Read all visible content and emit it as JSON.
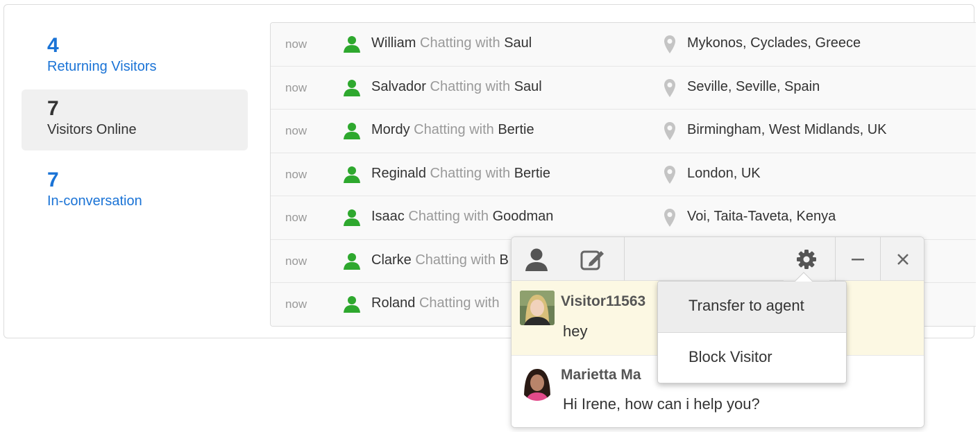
{
  "stats": [
    {
      "count": "4",
      "label": "Returning Visitors"
    },
    {
      "count": "7",
      "label": "Visitors Online"
    },
    {
      "count": "7",
      "label": "In-conversation"
    }
  ],
  "visitors": [
    {
      "time": "now",
      "name": "William",
      "status": "Chatting with",
      "agent": "Saul",
      "location": "Mykonos, Cyclades, Greece"
    },
    {
      "time": "now",
      "name": "Salvador",
      "status": "Chatting with",
      "agent": "Saul",
      "location": "Seville, Seville, Spain"
    },
    {
      "time": "now",
      "name": "Mordy",
      "status": "Chatting with",
      "agent": "Bertie",
      "location": "Birmingham, West Midlands, UK"
    },
    {
      "time": "now",
      "name": "Reginald",
      "status": "Chatting with",
      "agent": "Bertie",
      "location": "London, UK"
    },
    {
      "time": "now",
      "name": "Isaac",
      "status": "Chatting with",
      "agent": "Goodman",
      "location": "Voi, Taita-Taveta, Kenya"
    },
    {
      "time": "now",
      "name": "Clarke",
      "status": "Chatting with",
      "agent": "B",
      "location": ""
    },
    {
      "time": "now",
      "name": "Roland",
      "status": "Chatting with",
      "agent": "",
      "location": ""
    }
  ],
  "chat": {
    "messages": [
      {
        "sender": "Visitor11563",
        "text": "hey"
      },
      {
        "sender": "Marietta Ma",
        "text": "Hi Irene, how can i help you?"
      }
    ],
    "menu": {
      "transfer_label": "Transfer to agent",
      "block_label": "Block Visitor"
    }
  },
  "icons": {
    "visitor_row": "user-icon",
    "location": "map-pin-icon",
    "toolbar": [
      "user-icon",
      "edit-note-icon",
      "gear-icon",
      "minimize-icon",
      "close-icon"
    ]
  },
  "colors": {
    "link_blue": "#1a73d6",
    "online_green": "#2ea82e",
    "visitor_message_bg": "#fcf8e3",
    "active_stat_bg": "#f0f0f0"
  }
}
